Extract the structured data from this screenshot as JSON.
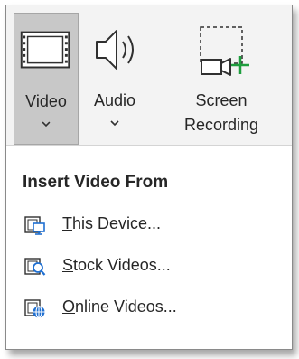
{
  "ribbon": {
    "video": {
      "label": "Video",
      "icon": "film-icon"
    },
    "audio": {
      "label": "Audio",
      "icon": "speaker-icon"
    },
    "screen": {
      "label_line1": "Screen",
      "label_line2": "Recording",
      "icon": "screen-recording-icon"
    }
  },
  "menu": {
    "heading": "Insert Video From",
    "items": [
      {
        "accel": "T",
        "rest": "his Device...",
        "icon": "device-video-icon"
      },
      {
        "accel": "S",
        "rest": "tock Videos...",
        "icon": "stock-video-icon"
      },
      {
        "accel": "O",
        "rest": "nline Videos...",
        "icon": "online-video-icon"
      }
    ]
  },
  "colors": {
    "accent_green": "#1e9e3e",
    "accent_blue": "#1f6fd1",
    "pressed_bg": "#c8c8c8"
  }
}
